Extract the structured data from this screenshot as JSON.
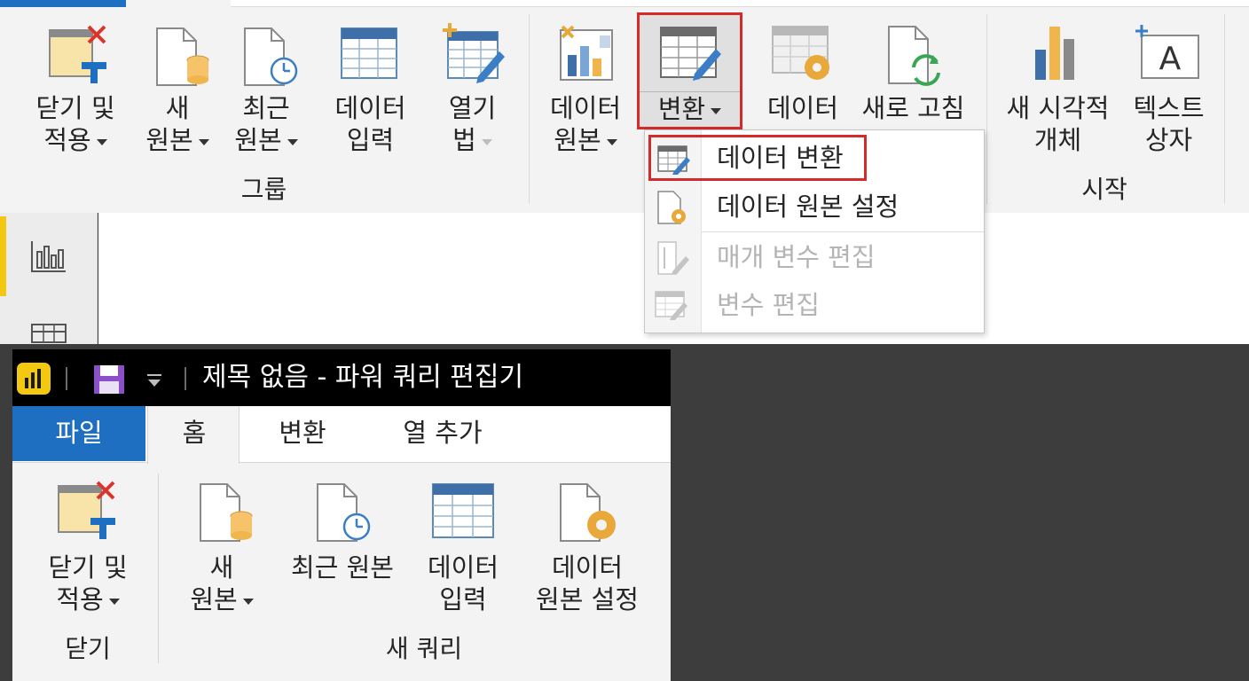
{
  "ribbon": {
    "group_label": "그룹",
    "start_label": "시작",
    "buttons": {
      "close_apply": {
        "line1": "닫기 및",
        "line2": "적용"
      },
      "new_source": {
        "line1": "새",
        "line2": "원본"
      },
      "recent_sources": {
        "line1": "최근",
        "line2": "원본"
      },
      "enter_data": {
        "line1": "데이터",
        "line2": "입력"
      },
      "open_with": {
        "line1": "열기",
        "line2": "법"
      },
      "data_source": {
        "line1": "데이터",
        "line2": "원본"
      },
      "transform": {
        "line1": "변환"
      },
      "data": {
        "line1": "데이터"
      },
      "refresh": {
        "line1": "새로 고침"
      },
      "new_visual": {
        "line1": "새 시각적",
        "line2": "개체"
      },
      "text_box": {
        "line1": "텍스트",
        "line2": "상자"
      }
    }
  },
  "dropdown": {
    "items": [
      {
        "label": "데이터 변환",
        "enabled": true
      },
      {
        "label": "데이터 원본 설정",
        "enabled": true
      },
      {
        "label": "매개 변수 편집",
        "enabled": false
      },
      {
        "label": "변수 편집",
        "enabled": false
      }
    ]
  },
  "editor": {
    "title": "제목 없음 - 파워 쿼리 편집기",
    "tabs": [
      "파일",
      "홈",
      "변환",
      "열 추가"
    ],
    "buttons": {
      "close_apply": {
        "line1": "닫기 및",
        "line2": "적용"
      },
      "new_source": {
        "line1": "새",
        "line2": "원본"
      },
      "recent_sources": {
        "line1": "최근 원본"
      },
      "enter_data": {
        "line1": "데이터",
        "line2": "입력"
      },
      "data_source_settings": {
        "line1": "데이터",
        "line2": "원본 설정"
      }
    },
    "groups": {
      "close": "닫기",
      "new_query": "새 쿼리"
    }
  },
  "colors": {
    "accent_blue": "#1e6fc1",
    "highlight_red": "#d42a2a",
    "powerbi_yellow": "#f2c811",
    "ribbon_bg": "#f3f3f3",
    "titlebar_bg": "#000000"
  }
}
